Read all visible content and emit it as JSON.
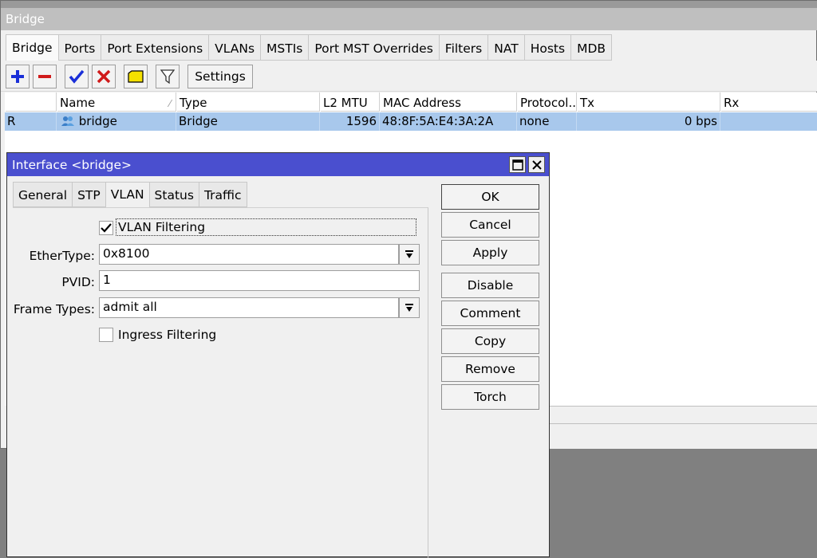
{
  "bridge_window": {
    "title": "Bridge",
    "tabs": [
      "Bridge",
      "Ports",
      "Port Extensions",
      "VLANs",
      "MSTIs",
      "Port MST Overrides",
      "Filters",
      "NAT",
      "Hosts",
      "MDB"
    ],
    "toolbar": {
      "settings_label": "Settings",
      "icons": [
        "add-icon",
        "remove-icon",
        "enable-check-icon",
        "disable-x-icon",
        "comment-note-icon",
        "filter-icon"
      ]
    },
    "table": {
      "headers": [
        "",
        "Name",
        "Type",
        "L2 MTU",
        "MAC Address",
        "Protocol...",
        "Tx",
        "Rx"
      ],
      "rows": [
        {
          "flag": "R",
          "name": "bridge",
          "type": "Bridge",
          "l2mtu": "1596",
          "mac": "48:8F:5A:E4:3A:2A",
          "protocol": "none",
          "tx": "0 bps",
          "rx": ""
        }
      ]
    }
  },
  "dialog": {
    "title": "Interface <bridge>",
    "tabs": [
      "General",
      "STP",
      "VLAN",
      "Status",
      "Traffic"
    ],
    "active_tab": "VLAN",
    "vlan_filtering": {
      "label": "VLAN Filtering",
      "checked": true
    },
    "ethertype": {
      "label": "EtherType:",
      "value": "0x8100"
    },
    "pvid": {
      "label": "PVID:",
      "value": "1"
    },
    "frame_types": {
      "label": "Frame Types:",
      "value": "admit all"
    },
    "ingress_filtering": {
      "label": "Ingress Filtering",
      "checked": false
    },
    "buttons": [
      "OK",
      "Cancel",
      "Apply",
      "Disable",
      "Comment",
      "Copy",
      "Remove",
      "Torch"
    ]
  },
  "colors": {
    "dialog_title": "#4a4fcf",
    "selected_row": "#a8c8ec",
    "add_icon": "#1a2fd8",
    "remove_icon": "#d01a1a",
    "check_icon": "#1a2fd8",
    "comment_icon": "#f5e100"
  }
}
